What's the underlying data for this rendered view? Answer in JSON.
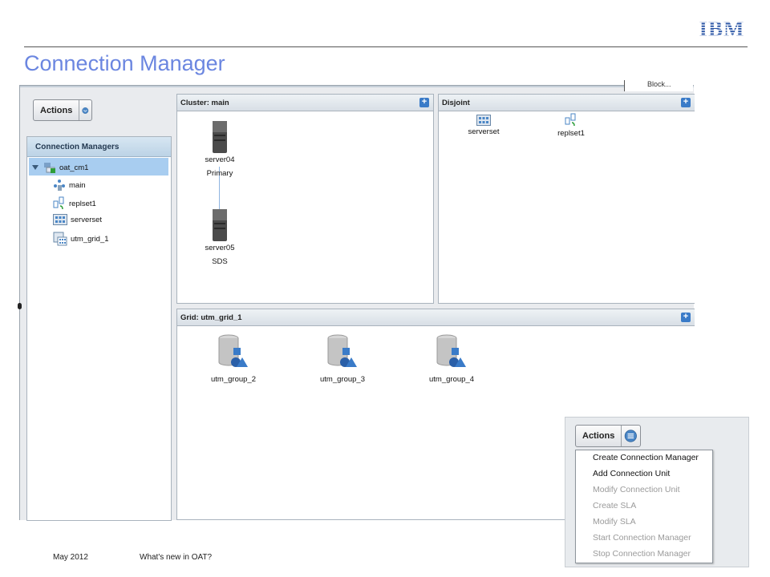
{
  "slide": {
    "title": "Connection Manager",
    "logo_text": "IBM",
    "footer_date": "May 2012",
    "footer_text": "What's new in OAT?"
  },
  "app": {
    "actions_label": "Actions",
    "fragment_text": "Block...",
    "connection_managers": {
      "header": "Connection Managers",
      "tree": [
        {
          "label": "oat_cm1",
          "icon": "connection-manager-icon",
          "selected": true
        },
        {
          "label": "main",
          "icon": "cluster-icon"
        },
        {
          "label": "replset1",
          "icon": "replset-icon"
        },
        {
          "label": "serverset",
          "icon": "serverset-icon"
        },
        {
          "label": "utm_grid_1",
          "icon": "grid-icon"
        }
      ]
    },
    "cluster_panel": {
      "header": "Cluster: main",
      "nodes": [
        {
          "name": "server04",
          "role": "Primary",
          "icon": "server-icon"
        },
        {
          "name": "server05",
          "role": "SDS",
          "icon": "server-icon"
        }
      ]
    },
    "disjoint_panel": {
      "header": "Disjoint",
      "nodes": [
        {
          "name": "serverset",
          "icon": "serverset-icon"
        },
        {
          "name": "replset1",
          "icon": "replset-icon"
        }
      ]
    },
    "grid_panel": {
      "header": "Grid: utm_grid_1",
      "groups": [
        {
          "name": "utm_group_2",
          "icon": "group-database-icon"
        },
        {
          "name": "utm_group_3",
          "icon": "group-database-icon"
        },
        {
          "name": "utm_group_4",
          "icon": "group-database-icon"
        }
      ]
    }
  },
  "actions_menu": {
    "button_label": "Actions",
    "items": [
      {
        "label": "Create Connection Manager",
        "enabled": true
      },
      {
        "label": "Add Connection Unit",
        "enabled": true
      },
      {
        "label": "Modify Connection Unit",
        "enabled": false
      },
      {
        "label": "Create SLA",
        "enabled": false
      },
      {
        "label": "Modify SLA",
        "enabled": false
      },
      {
        "label": "Start Connection Manager",
        "enabled": false
      },
      {
        "label": "Stop Connection Manager",
        "enabled": false
      }
    ]
  },
  "colors": {
    "title": "#6b86e0",
    "selection": "#a8cdf0",
    "panel_header": "#bcd3e6",
    "plus": "#3a7bc8",
    "disabled_text": "#9a9a9a"
  }
}
